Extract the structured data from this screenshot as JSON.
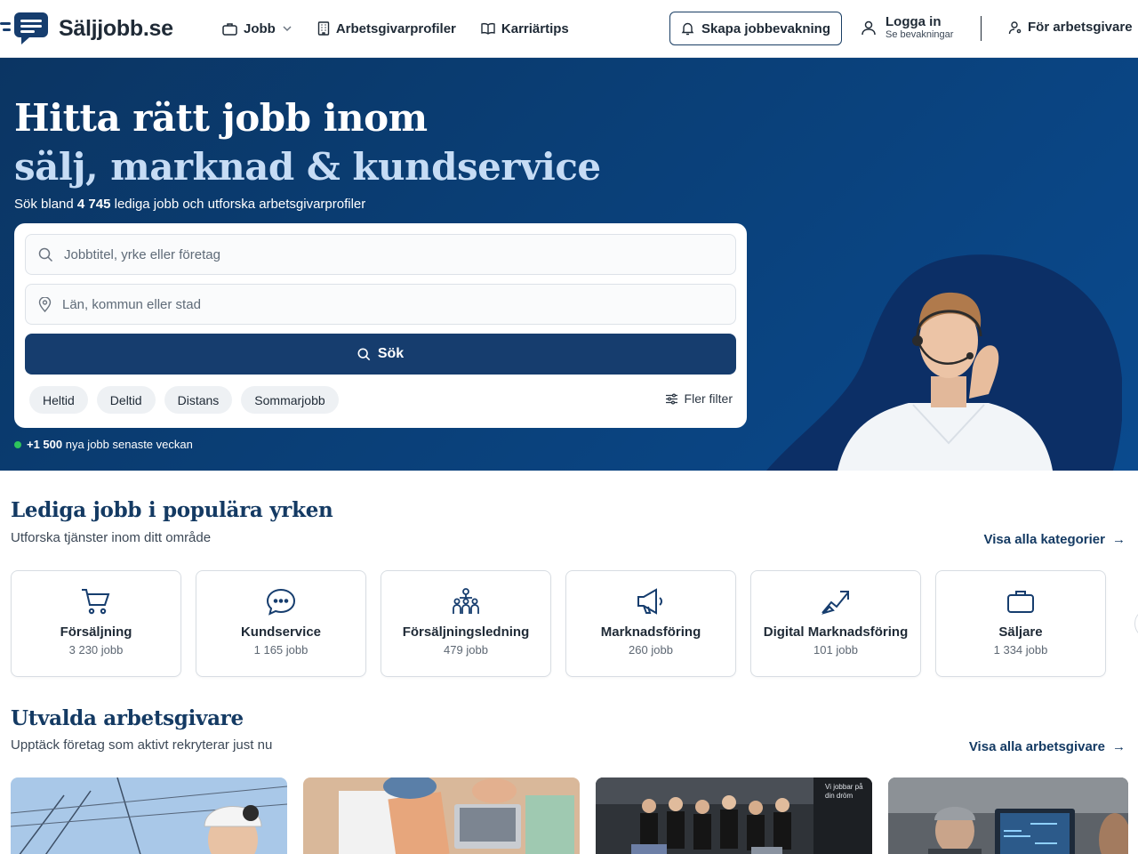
{
  "nav": {
    "logo_text": "Säljjobb.se",
    "links": [
      {
        "label": "Jobb",
        "icon": "briefcase-icon"
      },
      {
        "label": "Arbetsgivarprofiler",
        "icon": "building-icon"
      },
      {
        "label": "Karriärtips",
        "icon": "book-icon"
      }
    ],
    "alert_button": "Skapa jobbevakning",
    "login": {
      "title": "Logga in",
      "subtitle": "Se bevakningar"
    },
    "employers_link": "För arbetsgivare"
  },
  "hero": {
    "title_line1": "Hitta rätt jobb inom",
    "title_line2": "sälj, marknad & kundservice",
    "subtitle_pre": "Sök bland ",
    "job_count": "4 745",
    "subtitle_post": " lediga jobb och utforska arbetsgivarprofiler",
    "search": {
      "query_placeholder": "Jobbtitel, yrke eller företag",
      "location_placeholder": "Län, kommun eller stad",
      "button_label": "Sök"
    },
    "chips": [
      "Heltid",
      "Deltid",
      "Distans",
      "Sommarjobb"
    ],
    "more_filters": "Fler filter",
    "new_jobs_count": "+1 500",
    "new_jobs_text": " nya jobb senaste veckan"
  },
  "categories_section": {
    "title": "Lediga jobb i populära yrken",
    "subtitle": "Utforska tjänster inom ditt område",
    "link": "Visa alla kategorier",
    "items": [
      {
        "name": "Försäljning",
        "count": "3 230 jobb",
        "icon": "cart-icon"
      },
      {
        "name": "Kundservice",
        "count": "1 165 jobb",
        "icon": "chat-icon"
      },
      {
        "name": "Försäljningsledning",
        "count": "479 jobb",
        "icon": "team-icon"
      },
      {
        "name": "Marknadsföring",
        "count": "260 jobb",
        "icon": "megaphone-icon"
      },
      {
        "name": "Digital Marknadsföring",
        "count": "101 jobb",
        "icon": "trend-icon"
      },
      {
        "name": "Säljare",
        "count": "1 334 jobb",
        "icon": "briefcase-icon"
      }
    ]
  },
  "employers_section": {
    "title": "Utvalda arbetsgivare",
    "subtitle": "Upptäck företag som aktivt rekryterar just nu",
    "link": "Visa alla arbetsgivare",
    "cards": [
      {
        "image": "worker-photo"
      },
      {
        "image": "desk-photo"
      },
      {
        "image": "team-photo",
        "caption": "Vi jobbar på din dröm"
      },
      {
        "image": "office-photo"
      }
    ]
  },
  "colors": {
    "primary": "#163d6e",
    "hero_bg": "#0a3f77",
    "accent_green": "#2ec45c"
  }
}
